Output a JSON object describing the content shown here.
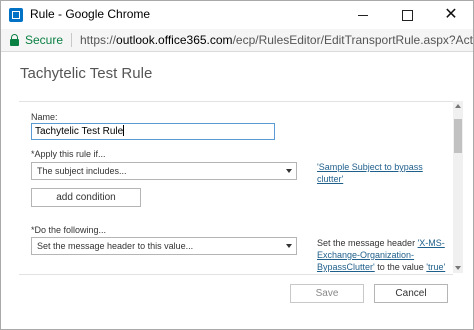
{
  "window": {
    "title": "Rule - Google Chrome",
    "controls": [
      "minimize",
      "maximize",
      "close"
    ]
  },
  "address_bar": {
    "security_label": "Secure",
    "url_scheme": "https://",
    "url_host": "outlook.office365.com",
    "url_path": "/ecp/RulesEditor/EditTransportRule.aspx?ActivityCorrelati..."
  },
  "dialog": {
    "title": "Tachytelic Test Rule",
    "name_label": "Name:",
    "name_value": "Tachytelic Test Rule",
    "condition_label": "*Apply this rule if...",
    "condition_value": "The subject includes...",
    "condition_link": "'Sample Subject to bypass clutter'",
    "add_condition_label": "add condition",
    "action_label": "*Do the following...",
    "action_value": "Set the message header to this value...",
    "action_desc_prefix": "Set the message header ",
    "action_header_link": "'X-MS-Exchange-Organization-BypassClutter'",
    "action_desc_middle": " to the value ",
    "action_value_link": "'true'"
  },
  "footer": {
    "save_label": "Save",
    "cancel_label": "Cancel"
  },
  "colors": {
    "secure_green": "#0b8043",
    "link_blue": "#1f5f8b",
    "input_focus_border": "#5b9bd5"
  },
  "icons": [
    "app-icon",
    "lock-icon",
    "caret-down-icon",
    "scroll-up-arrow-icon",
    "scroll-down-arrow-icon"
  ]
}
